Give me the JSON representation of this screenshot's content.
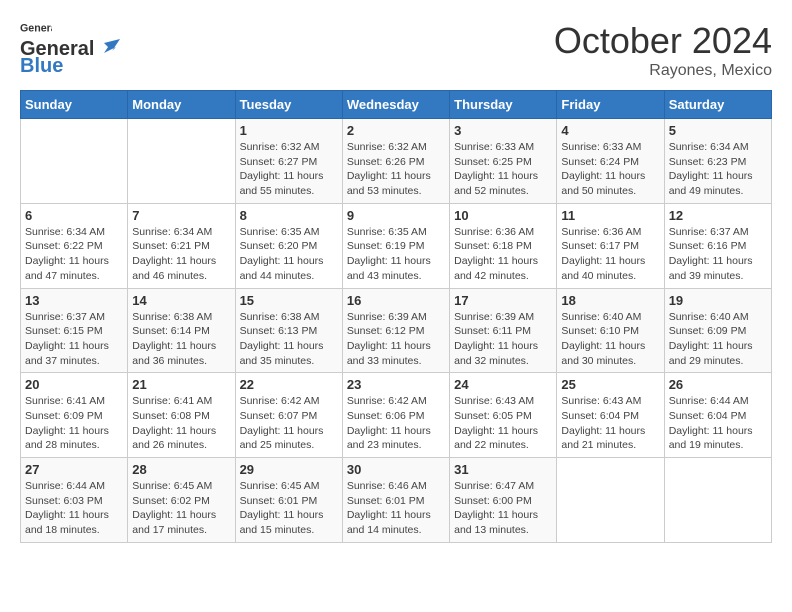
{
  "header": {
    "logo_general": "General",
    "logo_blue": "Blue",
    "month": "October 2024",
    "location": "Rayones, Mexico"
  },
  "weekdays": [
    "Sunday",
    "Monday",
    "Tuesday",
    "Wednesday",
    "Thursday",
    "Friday",
    "Saturday"
  ],
  "weeks": [
    [
      {
        "day": "",
        "info": ""
      },
      {
        "day": "",
        "info": ""
      },
      {
        "day": "1",
        "info": "Sunrise: 6:32 AM\nSunset: 6:27 PM\nDaylight: 11 hours and 55 minutes."
      },
      {
        "day": "2",
        "info": "Sunrise: 6:32 AM\nSunset: 6:26 PM\nDaylight: 11 hours and 53 minutes."
      },
      {
        "day": "3",
        "info": "Sunrise: 6:33 AM\nSunset: 6:25 PM\nDaylight: 11 hours and 52 minutes."
      },
      {
        "day": "4",
        "info": "Sunrise: 6:33 AM\nSunset: 6:24 PM\nDaylight: 11 hours and 50 minutes."
      },
      {
        "day": "5",
        "info": "Sunrise: 6:34 AM\nSunset: 6:23 PM\nDaylight: 11 hours and 49 minutes."
      }
    ],
    [
      {
        "day": "6",
        "info": "Sunrise: 6:34 AM\nSunset: 6:22 PM\nDaylight: 11 hours and 47 minutes."
      },
      {
        "day": "7",
        "info": "Sunrise: 6:34 AM\nSunset: 6:21 PM\nDaylight: 11 hours and 46 minutes."
      },
      {
        "day": "8",
        "info": "Sunrise: 6:35 AM\nSunset: 6:20 PM\nDaylight: 11 hours and 44 minutes."
      },
      {
        "day": "9",
        "info": "Sunrise: 6:35 AM\nSunset: 6:19 PM\nDaylight: 11 hours and 43 minutes."
      },
      {
        "day": "10",
        "info": "Sunrise: 6:36 AM\nSunset: 6:18 PM\nDaylight: 11 hours and 42 minutes."
      },
      {
        "day": "11",
        "info": "Sunrise: 6:36 AM\nSunset: 6:17 PM\nDaylight: 11 hours and 40 minutes."
      },
      {
        "day": "12",
        "info": "Sunrise: 6:37 AM\nSunset: 6:16 PM\nDaylight: 11 hours and 39 minutes."
      }
    ],
    [
      {
        "day": "13",
        "info": "Sunrise: 6:37 AM\nSunset: 6:15 PM\nDaylight: 11 hours and 37 minutes."
      },
      {
        "day": "14",
        "info": "Sunrise: 6:38 AM\nSunset: 6:14 PM\nDaylight: 11 hours and 36 minutes."
      },
      {
        "day": "15",
        "info": "Sunrise: 6:38 AM\nSunset: 6:13 PM\nDaylight: 11 hours and 35 minutes."
      },
      {
        "day": "16",
        "info": "Sunrise: 6:39 AM\nSunset: 6:12 PM\nDaylight: 11 hours and 33 minutes."
      },
      {
        "day": "17",
        "info": "Sunrise: 6:39 AM\nSunset: 6:11 PM\nDaylight: 11 hours and 32 minutes."
      },
      {
        "day": "18",
        "info": "Sunrise: 6:40 AM\nSunset: 6:10 PM\nDaylight: 11 hours and 30 minutes."
      },
      {
        "day": "19",
        "info": "Sunrise: 6:40 AM\nSunset: 6:09 PM\nDaylight: 11 hours and 29 minutes."
      }
    ],
    [
      {
        "day": "20",
        "info": "Sunrise: 6:41 AM\nSunset: 6:09 PM\nDaylight: 11 hours and 28 minutes."
      },
      {
        "day": "21",
        "info": "Sunrise: 6:41 AM\nSunset: 6:08 PM\nDaylight: 11 hours and 26 minutes."
      },
      {
        "day": "22",
        "info": "Sunrise: 6:42 AM\nSunset: 6:07 PM\nDaylight: 11 hours and 25 minutes."
      },
      {
        "day": "23",
        "info": "Sunrise: 6:42 AM\nSunset: 6:06 PM\nDaylight: 11 hours and 23 minutes."
      },
      {
        "day": "24",
        "info": "Sunrise: 6:43 AM\nSunset: 6:05 PM\nDaylight: 11 hours and 22 minutes."
      },
      {
        "day": "25",
        "info": "Sunrise: 6:43 AM\nSunset: 6:04 PM\nDaylight: 11 hours and 21 minutes."
      },
      {
        "day": "26",
        "info": "Sunrise: 6:44 AM\nSunset: 6:04 PM\nDaylight: 11 hours and 19 minutes."
      }
    ],
    [
      {
        "day": "27",
        "info": "Sunrise: 6:44 AM\nSunset: 6:03 PM\nDaylight: 11 hours and 18 minutes."
      },
      {
        "day": "28",
        "info": "Sunrise: 6:45 AM\nSunset: 6:02 PM\nDaylight: 11 hours and 17 minutes."
      },
      {
        "day": "29",
        "info": "Sunrise: 6:45 AM\nSunset: 6:01 PM\nDaylight: 11 hours and 15 minutes."
      },
      {
        "day": "30",
        "info": "Sunrise: 6:46 AM\nSunset: 6:01 PM\nDaylight: 11 hours and 14 minutes."
      },
      {
        "day": "31",
        "info": "Sunrise: 6:47 AM\nSunset: 6:00 PM\nDaylight: 11 hours and 13 minutes."
      },
      {
        "day": "",
        "info": ""
      },
      {
        "day": "",
        "info": ""
      }
    ]
  ]
}
